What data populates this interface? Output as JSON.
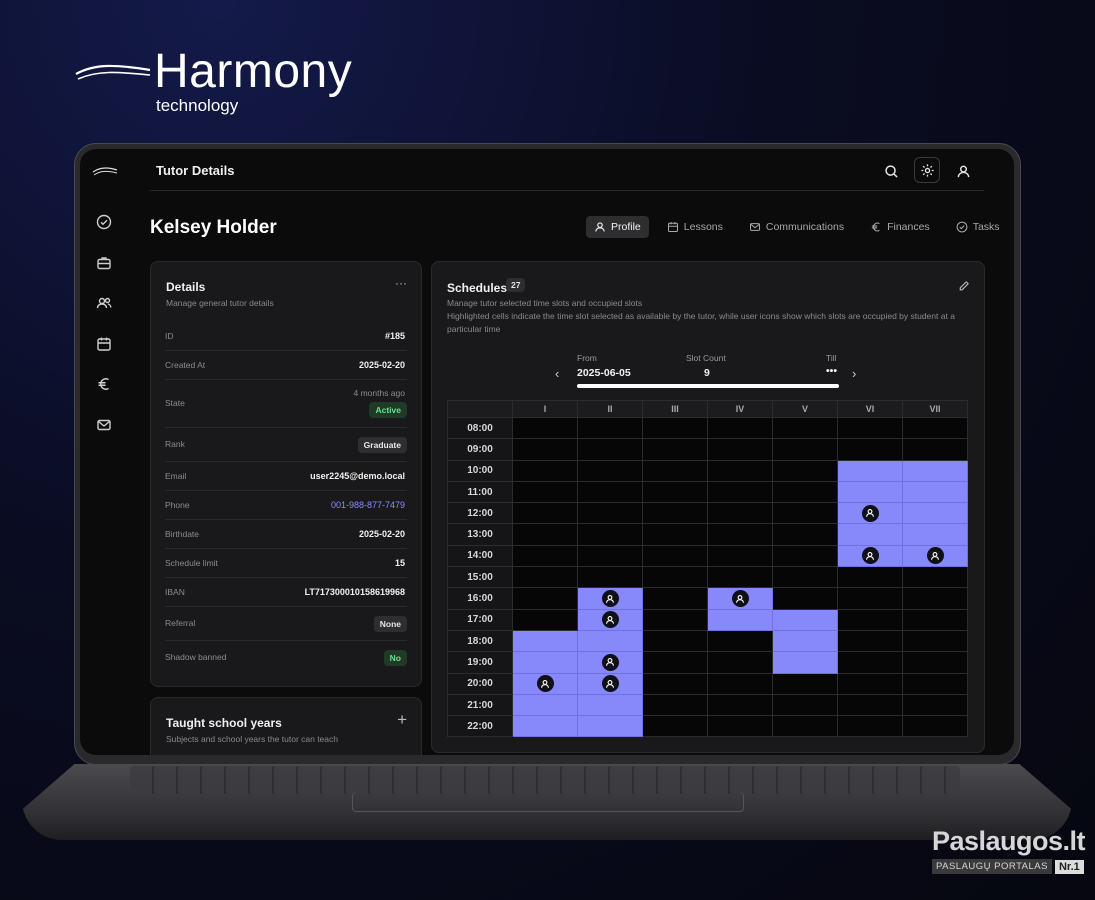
{
  "brand": {
    "name": "Harmony",
    "sub": "technology"
  },
  "header": {
    "title": "Tutor Details"
  },
  "tutor": {
    "name": "Kelsey Holder"
  },
  "tabs": [
    {
      "label": "Profile",
      "icon": "user-icon",
      "active": true
    },
    {
      "label": "Lessons",
      "icon": "calendar-icon",
      "active": false
    },
    {
      "label": "Communications",
      "icon": "mail-icon",
      "active": false
    },
    {
      "label": "Finances",
      "icon": "euro-icon",
      "active": false
    },
    {
      "label": "Tasks",
      "icon": "check-circle-icon",
      "active": false
    }
  ],
  "sidebar": {
    "icons": [
      "check-circle-icon",
      "briefcase-icon",
      "users-icon",
      "calendar-icon",
      "euro-icon",
      "mail-icon"
    ]
  },
  "details": {
    "title": "Details",
    "subtitle": "Manage general tutor details",
    "rows": [
      {
        "label": "ID",
        "value": "#185",
        "type": "text"
      },
      {
        "label": "Created At",
        "value": "2025-02-20",
        "type": "text"
      },
      {
        "label": "State",
        "value": "Active",
        "note": "4 months ago",
        "type": "badge-green"
      },
      {
        "label": "Rank",
        "value": "Graduate",
        "type": "badge"
      },
      {
        "label": "Email",
        "value": "user2245@demo.local",
        "type": "text"
      },
      {
        "label": "Phone",
        "value": "001-988-877-7479",
        "type": "link"
      },
      {
        "label": "Birthdate",
        "value": "2025-02-20",
        "type": "text"
      },
      {
        "label": "Schedule limit",
        "value": "15",
        "type": "text"
      },
      {
        "label": "IBAN",
        "value": "LT717300010158619968",
        "type": "text"
      },
      {
        "label": "Referral",
        "value": "None",
        "type": "badge"
      },
      {
        "label": "Shadow banned",
        "value": "No",
        "type": "badge-green"
      }
    ]
  },
  "taught": {
    "title": "Taught school years",
    "subtitle": "Subjects and school years the tutor can teach"
  },
  "schedules": {
    "title": "Schedules",
    "count": "27",
    "subtitle1": "Manage tutor selected time slots and occupied slots",
    "subtitle2": "Highlighted cells indicate the time slot selected as available by the tutor, while user icons show which slots are occupied by student at a",
    "subtitle3": "particular time",
    "from_label": "From",
    "from_value": "2025-06-05",
    "count_label": "Slot Count",
    "count_value": "9",
    "till_label": "Till",
    "till_value": "•••",
    "days": [
      "I",
      "II",
      "III",
      "IV",
      "V",
      "VI",
      "VII"
    ],
    "times": [
      "08:00",
      "09:00",
      "10:00",
      "11:00",
      "12:00",
      "13:00",
      "14:00",
      "15:00",
      "16:00",
      "17:00",
      "18:00",
      "19:00",
      "20:00",
      "21:00",
      "22:00"
    ],
    "selected": {
      "I": [
        "18:00",
        "19:00",
        "20:00",
        "21:00",
        "22:00"
      ],
      "II": [
        "16:00",
        "17:00",
        "18:00",
        "19:00",
        "20:00",
        "21:00",
        "22:00"
      ],
      "IV": [
        "16:00",
        "17:00"
      ],
      "V": [
        "17:00",
        "18:00",
        "19:00"
      ],
      "VI": [
        "10:00",
        "11:00",
        "12:00",
        "13:00",
        "14:00"
      ],
      "VII": [
        "10:00",
        "11:00",
        "12:00",
        "13:00",
        "14:00"
      ]
    },
    "occupied": {
      "I": [
        "20:00"
      ],
      "II": [
        "16:00",
        "17:00",
        "19:00",
        "20:00"
      ],
      "IV": [
        "16:00"
      ],
      "VI": [
        "12:00",
        "14:00"
      ],
      "VII": [
        "14:00"
      ]
    },
    "accent": "#8789fb"
  },
  "watermark": {
    "main": "Paslaugos.lt",
    "sub": "PASLAUGŲ PORTALAS",
    "nr": "Nr.1"
  }
}
